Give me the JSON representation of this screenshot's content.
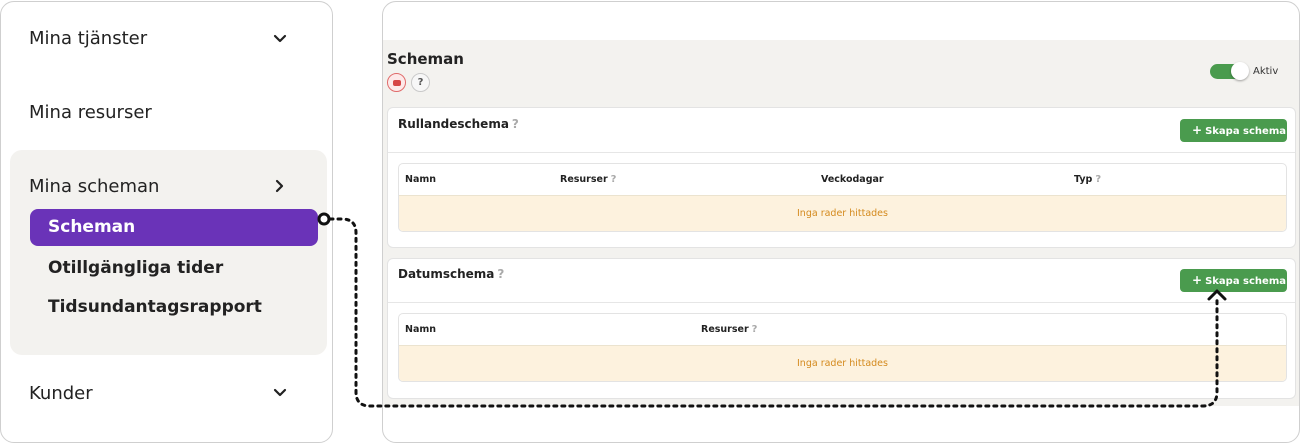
{
  "menu": {
    "services_label": "Mina tjänster",
    "resources_label": "Mina resurser",
    "schedules_label": "Mina scheman",
    "sub_items": {
      "schedules": "Scheman",
      "unavailable": "Otillgängliga tider",
      "exceptions": "Tidsundantagsrapport"
    },
    "customers_label": "Kunder"
  },
  "app": {
    "title": "Scheman",
    "toggle_label": "Aktiv",
    "toggle_on": true,
    "rolling": {
      "title": "Rullandeschema",
      "button": "Skapa schema",
      "columns": [
        "Namn",
        "Resurser",
        "Veckodagar",
        "Typ"
      ],
      "empty": "Inga rader hittades"
    },
    "date": {
      "title": "Datumschema",
      "button": "Skapa schema",
      "columns": [
        "Namn",
        "Resurser"
      ],
      "empty": "Inga rader hittades"
    }
  },
  "colors": {
    "accent_purple": "#6a33b8",
    "button_green": "#4a9b4e",
    "empty_row_bg": "#fdf2de",
    "empty_row_text": "#d48a1e"
  },
  "icons": [
    "chevron-down-icon",
    "chevron-right-icon",
    "youtube-icon",
    "help-icon",
    "plus-icon"
  ]
}
